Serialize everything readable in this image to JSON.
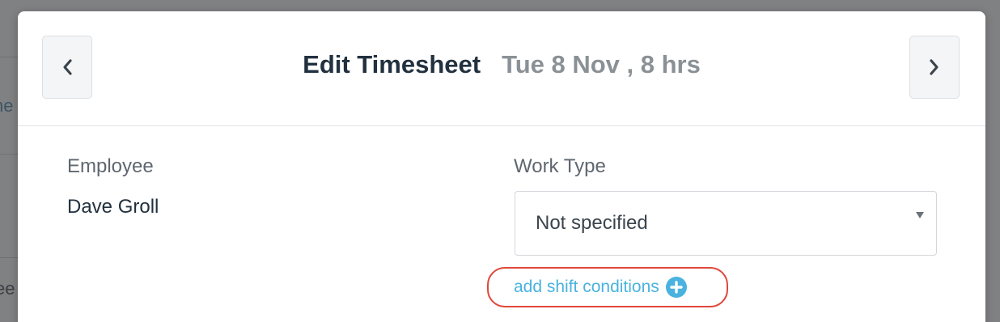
{
  "background": {
    "fragment_top": "ne",
    "fragment_bottom": "ee"
  },
  "modal": {
    "title": "Edit Timesheet",
    "subtitle": "Tue 8 Nov , 8 hrs",
    "prev_icon": "chevron-left-icon",
    "next_icon": "chevron-right-icon"
  },
  "form": {
    "employee_label": "Employee",
    "employee_value": "Dave Groll",
    "work_type_label": "Work Type",
    "work_type_value": "Not specified",
    "add_shift_conditions": "add shift conditions",
    "add_icon": "plus-circle-icon"
  },
  "colors": {
    "link": "#4ab2df",
    "highlight": "#e0473a",
    "title": "#22313f"
  }
}
